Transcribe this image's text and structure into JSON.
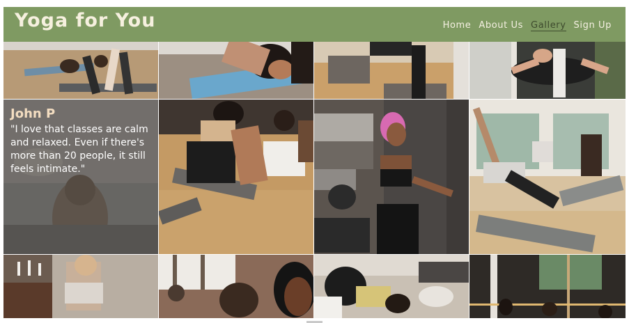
{
  "header": {
    "logo": "Yoga for You",
    "nav": [
      {
        "label": "Home",
        "active": false
      },
      {
        "label": "About Us",
        "active": false
      },
      {
        "label": "Gallery",
        "active": true
      },
      {
        "label": "Sign Up",
        "active": false
      }
    ]
  },
  "testimonial": {
    "name": "John P",
    "quote": "\"I love that classes are calm and relaxed. Even if there's more than 20 people, it still feels intimate.\""
  },
  "colors": {
    "header_bg": "#7f9a62",
    "logo": "#f6f0df",
    "nav_text": "#f5f0e2",
    "nav_active": "#3d4a2d",
    "testimonial_name": "#f2dcc0"
  }
}
